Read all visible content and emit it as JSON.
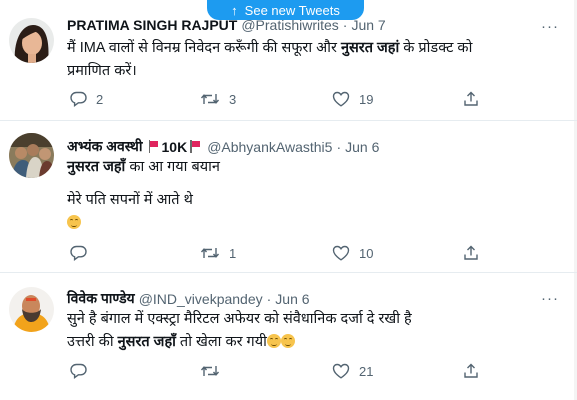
{
  "banner": {
    "label": "See new Tweets",
    "color": "#1d9bf0"
  },
  "tweets": [
    {
      "name": "PRATIMA SINGH RAJPUT",
      "handle": "@Pratishiwrites",
      "sep": "·",
      "date": "Jun 7",
      "line1_pre": "मैं IMA वालों से विनम्र निवेदन करूँगी की सफूरा और ",
      "line1_bold": "नुसरत जहां",
      "line1_post": " के प्रोडक्ट को",
      "line2": "प्रमाणित करें।",
      "replies": "2",
      "retweets": "3",
      "likes": "19"
    },
    {
      "name": "अभ्यंक अवस्थी",
      "badge": "10K",
      "handle": "@AbhyankAwasthi5",
      "sep": "·",
      "date": "Jun 6",
      "line1_bold": "नुसरत जहाँ",
      "line1_post": " का आ गया बयान",
      "line2": "मेरे पति सपनों में आते थे",
      "replies": "",
      "retweets": "1",
      "likes": "10"
    },
    {
      "name": "विवेक पाण्डेय",
      "handle": "@IND_vivekpandey",
      "sep": "·",
      "date": "Jun 6",
      "line1": "सुने है बंगाल में एक्स्ट्रा मैरिटल अफेयर को संवैधानिक दर्जा दे रखी है",
      "line2_pre": "उत्तरी की ",
      "line2_bold": "नुसरत जहाँ",
      "line2_post": " तो खेला कर गयी",
      "replies": "",
      "retweets": "",
      "likes": "21"
    }
  ],
  "icons": [
    "arrow-up-icon",
    "reply-icon",
    "retweet-icon",
    "like-icon",
    "share-icon",
    "more-icon",
    "flag-icon",
    "smiling-face-emoji"
  ]
}
